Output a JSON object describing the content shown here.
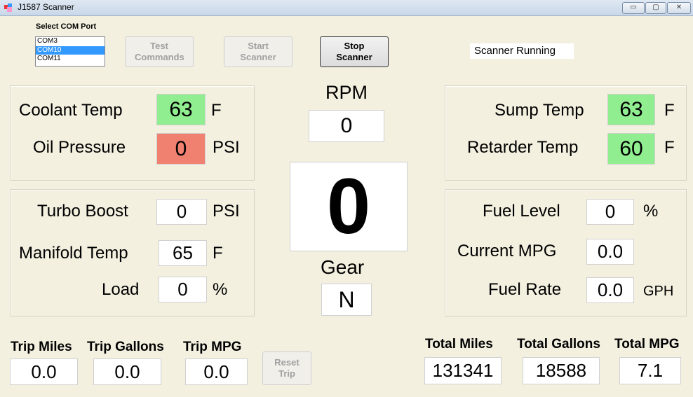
{
  "window": {
    "title": "J1587 Scanner",
    "controls": [
      "▭",
      "▢",
      "✕"
    ]
  },
  "com": {
    "label": "Select COM Port",
    "options": [
      "COM3",
      "COM10",
      "COM11"
    ],
    "selected_index": 1
  },
  "buttons": {
    "test": "Test Commands",
    "start": "Start Scanner",
    "stop": "Stop Scanner",
    "reset": "Reset Trip"
  },
  "status": "Scanner Running",
  "left_top": {
    "coolant_label": "Coolant Temp",
    "coolant_value": "63",
    "coolant_unit": "F",
    "oil_label": "Oil Pressure",
    "oil_value": "0",
    "oil_unit": "PSI"
  },
  "left_bottom": {
    "turbo_label": "Turbo Boost",
    "turbo_value": "0",
    "turbo_unit": "PSI",
    "manifold_label": "Manifold Temp",
    "manifold_value": "65",
    "manifold_unit": "F",
    "load_label": "Load",
    "load_value": "0",
    "load_unit": "%"
  },
  "center": {
    "rpm_label": "RPM",
    "rpm_value": "0",
    "speed_value": "0",
    "gear_label": "Gear",
    "gear_value": "N"
  },
  "right_top": {
    "sump_label": "Sump Temp",
    "sump_value": "63",
    "sump_unit": "F",
    "retarder_label": "Retarder Temp",
    "retarder_value": "60",
    "retarder_unit": "F"
  },
  "right_bottom": {
    "fuel_level_label": "Fuel Level",
    "fuel_level_value": "0",
    "fuel_level_unit": "%",
    "mpg_label": "Current MPG",
    "mpg_value": "0.0",
    "fuel_rate_label": "Fuel Rate",
    "fuel_rate_value": "0.0",
    "fuel_rate_unit": "GPH"
  },
  "trip": {
    "miles_label": "Trip Miles",
    "miles_value": "0.0",
    "gallons_label": "Trip Gallons",
    "gallons_value": "0.0",
    "mpg_label": "Trip MPG",
    "mpg_value": "0.0"
  },
  "totals": {
    "miles_label": "Total Miles",
    "miles_value": "131341",
    "gallons_label": "Total Gallons",
    "gallons_value": "18588",
    "mpg_label": "Total MPG",
    "mpg_value": "7.1"
  },
  "colors": {
    "ok": "#90ee90",
    "alert": "#f08070",
    "selection": "#3399ff"
  }
}
